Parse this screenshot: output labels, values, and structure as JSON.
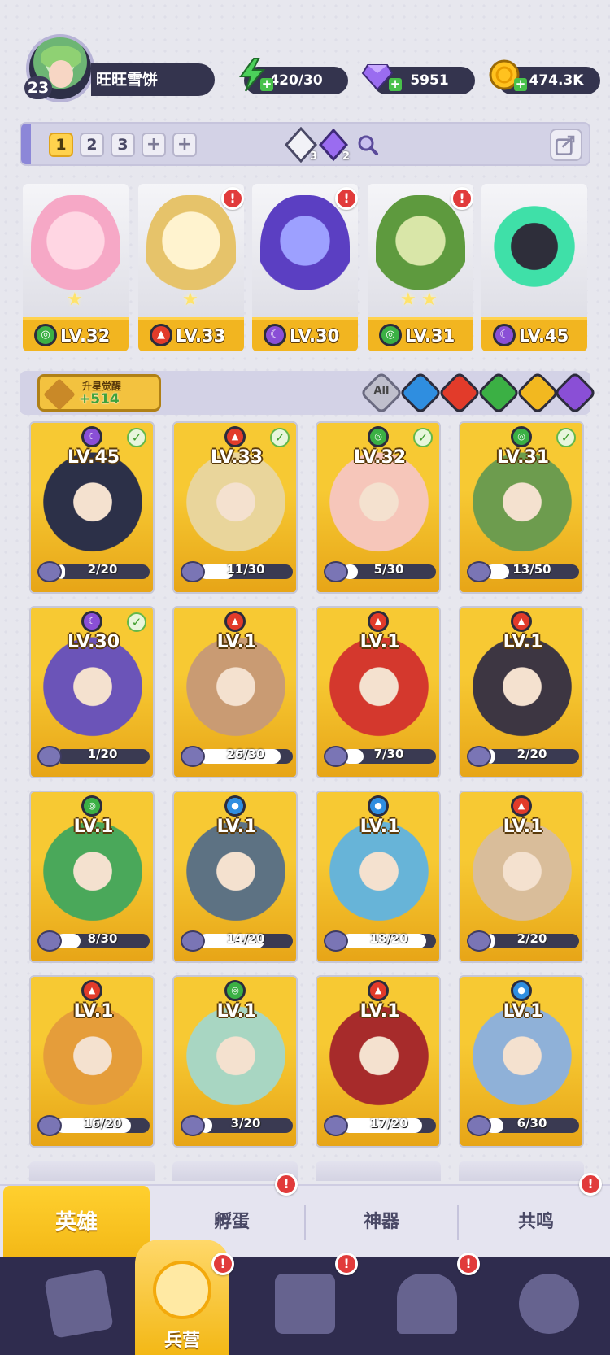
{
  "player": {
    "level": "23",
    "name": "旺旺雪饼"
  },
  "resources": {
    "energy": "420/30",
    "gems": "5951",
    "gold": "474.3K"
  },
  "team_bar": {
    "slots": [
      "1",
      "2",
      "3",
      "+",
      "+"
    ],
    "active_slot": "1",
    "crystal_white_count": "3",
    "crystal_purple_count": "2"
  },
  "team": [
    {
      "level": "LV.32",
      "element": "green"
    },
    {
      "level": "LV.33",
      "element": "red"
    },
    {
      "level": "LV.30",
      "element": "purple"
    },
    {
      "level": "LV.31",
      "element": "green"
    },
    {
      "level": "LV.45",
      "element": "purple"
    }
  ],
  "filter_bar": {
    "awaken_title": "升星觉醒",
    "awaken_value": "+514",
    "filters": [
      "All",
      "water",
      "fire",
      "wind",
      "light",
      "dark"
    ]
  },
  "heroes": [
    {
      "level": "LV.45",
      "element": "purple",
      "shards": "2/20",
      "progress": 0.1,
      "checked": true,
      "art": "#2c3048"
    },
    {
      "level": "LV.33",
      "element": "red",
      "shards": "11/30",
      "progress": 0.37,
      "checked": true,
      "art": "#e9d59b"
    },
    {
      "level": "LV.32",
      "element": "green",
      "shards": "5/30",
      "progress": 0.17,
      "checked": true,
      "art": "#f6c6ba"
    },
    {
      "level": "LV.31",
      "element": "green",
      "shards": "13/50",
      "progress": 0.26,
      "checked": true,
      "art": "#6d9c4e"
    },
    {
      "level": "LV.30",
      "element": "purple",
      "shards": "1/20",
      "progress": 0.05,
      "checked": true,
      "art": "#6b54b8"
    },
    {
      "level": "LV.1",
      "element": "red",
      "shards": "26/30",
      "progress": 0.87,
      "checked": false,
      "art": "#c99b73"
    },
    {
      "level": "LV.1",
      "element": "red",
      "shards": "7/30",
      "progress": 0.23,
      "checked": false,
      "art": "#d4382d"
    },
    {
      "level": "LV.1",
      "element": "red",
      "shards": "2/20",
      "progress": 0.1,
      "checked": false,
      "art": "#3d3642"
    },
    {
      "level": "LV.1",
      "element": "green",
      "shards": "8/30",
      "progress": 0.27,
      "checked": false,
      "art": "#4aa85a"
    },
    {
      "level": "LV.1",
      "element": "blue",
      "shards": "14/20",
      "progress": 0.7,
      "checked": false,
      "art": "#5d7283"
    },
    {
      "level": "LV.1",
      "element": "blue",
      "shards": "18/20",
      "progress": 0.9,
      "checked": false,
      "art": "#67b4d8"
    },
    {
      "level": "LV.1",
      "element": "red",
      "shards": "2/20",
      "progress": 0.1,
      "checked": false,
      "art": "#d9bd9a"
    },
    {
      "level": "LV.1",
      "element": "red",
      "shards": "16/20",
      "progress": 0.8,
      "checked": false,
      "art": "#e59d3a"
    },
    {
      "level": "LV.1",
      "element": "green",
      "shards": "3/20",
      "progress": 0.15,
      "checked": false,
      "art": "#a8d6c2"
    },
    {
      "level": "LV.1",
      "element": "red",
      "shards": "17/20",
      "progress": 0.85,
      "checked": false,
      "art": "#a72b2b"
    },
    {
      "level": "LV.1",
      "element": "blue",
      "shards": "6/30",
      "progress": 0.2,
      "checked": false,
      "art": "#8fb1d8"
    }
  ],
  "tabs": {
    "heroes": "英雄",
    "hatch": "孵蛋",
    "artifact": "神器",
    "resonance": "共鸣"
  },
  "bottom_nav": {
    "barracks": "兵营"
  },
  "colors": {
    "green": "#3bb044",
    "red": "#e23b2a",
    "purple": "#8a4fd6",
    "blue": "#2f8ee0",
    "light": "#f2b820",
    "gold_bar": "#f2b520",
    "alert_red": "#e13b3b"
  }
}
